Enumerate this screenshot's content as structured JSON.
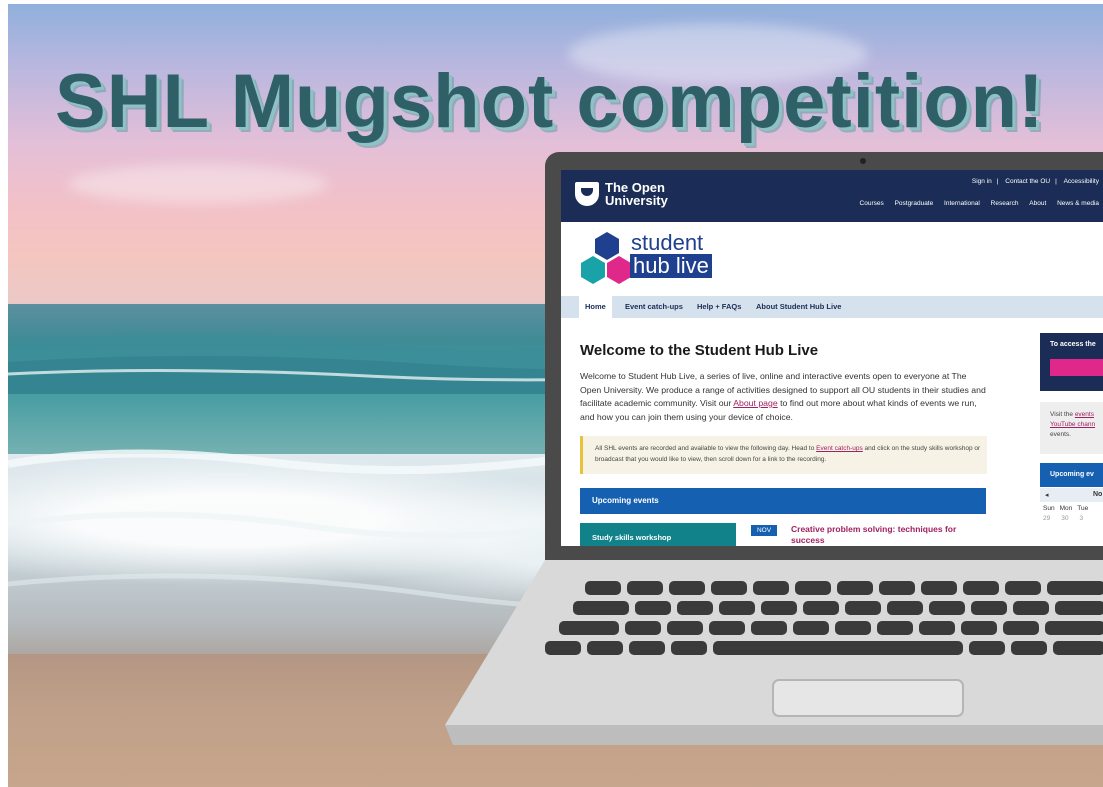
{
  "headline": "SHL Mugshot competition!",
  "ou": {
    "logo_text": "The Open University",
    "top_links": [
      "Sign in",
      "Contact the OU",
      "Accessibility"
    ],
    "main_nav": [
      "Courses",
      "Postgraduate",
      "International",
      "Research",
      "About",
      "News & media"
    ]
  },
  "shl": {
    "logo_line1": "student",
    "logo_line2": "hub live",
    "tabs": [
      "Home",
      "Event catch-ups",
      "Help + FAQs",
      "About Student Hub Live"
    ],
    "welcome_title": "Welcome to the Student Hub Live",
    "welcome_p1": "Welcome to Student Hub Live, a series of live, online and interactive events open to everyone at The Open University. We produce a range of activities designed to support all OU students in their studies and facilitate academic community. Visit our ",
    "welcome_link": "About page",
    "welcome_p2": " to find out more about what kinds of events we run, and how you can join them using your device of choice.",
    "notice_p1": "All SHL events are recorded and available to view the following day. Head to ",
    "notice_link": "Event catch-ups",
    "notice_p2": " and click on the study skills workshop or broadcast that you would like to view, then scroll down for a link to the recording.",
    "upcoming_label": "Upcoming events",
    "event_type": "Study skills workshop",
    "event_month": "NOV",
    "event_title": "Creative problem solving: techniques for success",
    "sidebar": {
      "access_text": "To access the",
      "visit_p1": "Visit the ",
      "visit_link1": "events",
      "visit_link2": "YouTube chann",
      "visit_p2": "events.",
      "upcoming_label": "Upcoming ev",
      "cal_prev": "◂",
      "cal_month": "No",
      "cal_days": [
        "Sun",
        "Mon",
        "Tue"
      ],
      "cal_nums": [
        "29",
        "30",
        "3"
      ]
    }
  },
  "colors": {
    "ou_navy": "#1b2d56",
    "shl_blue": "#1560b0",
    "shl_pink": "#e0288a",
    "shl_teal": "#12828a",
    "headline": "#2f6068"
  }
}
